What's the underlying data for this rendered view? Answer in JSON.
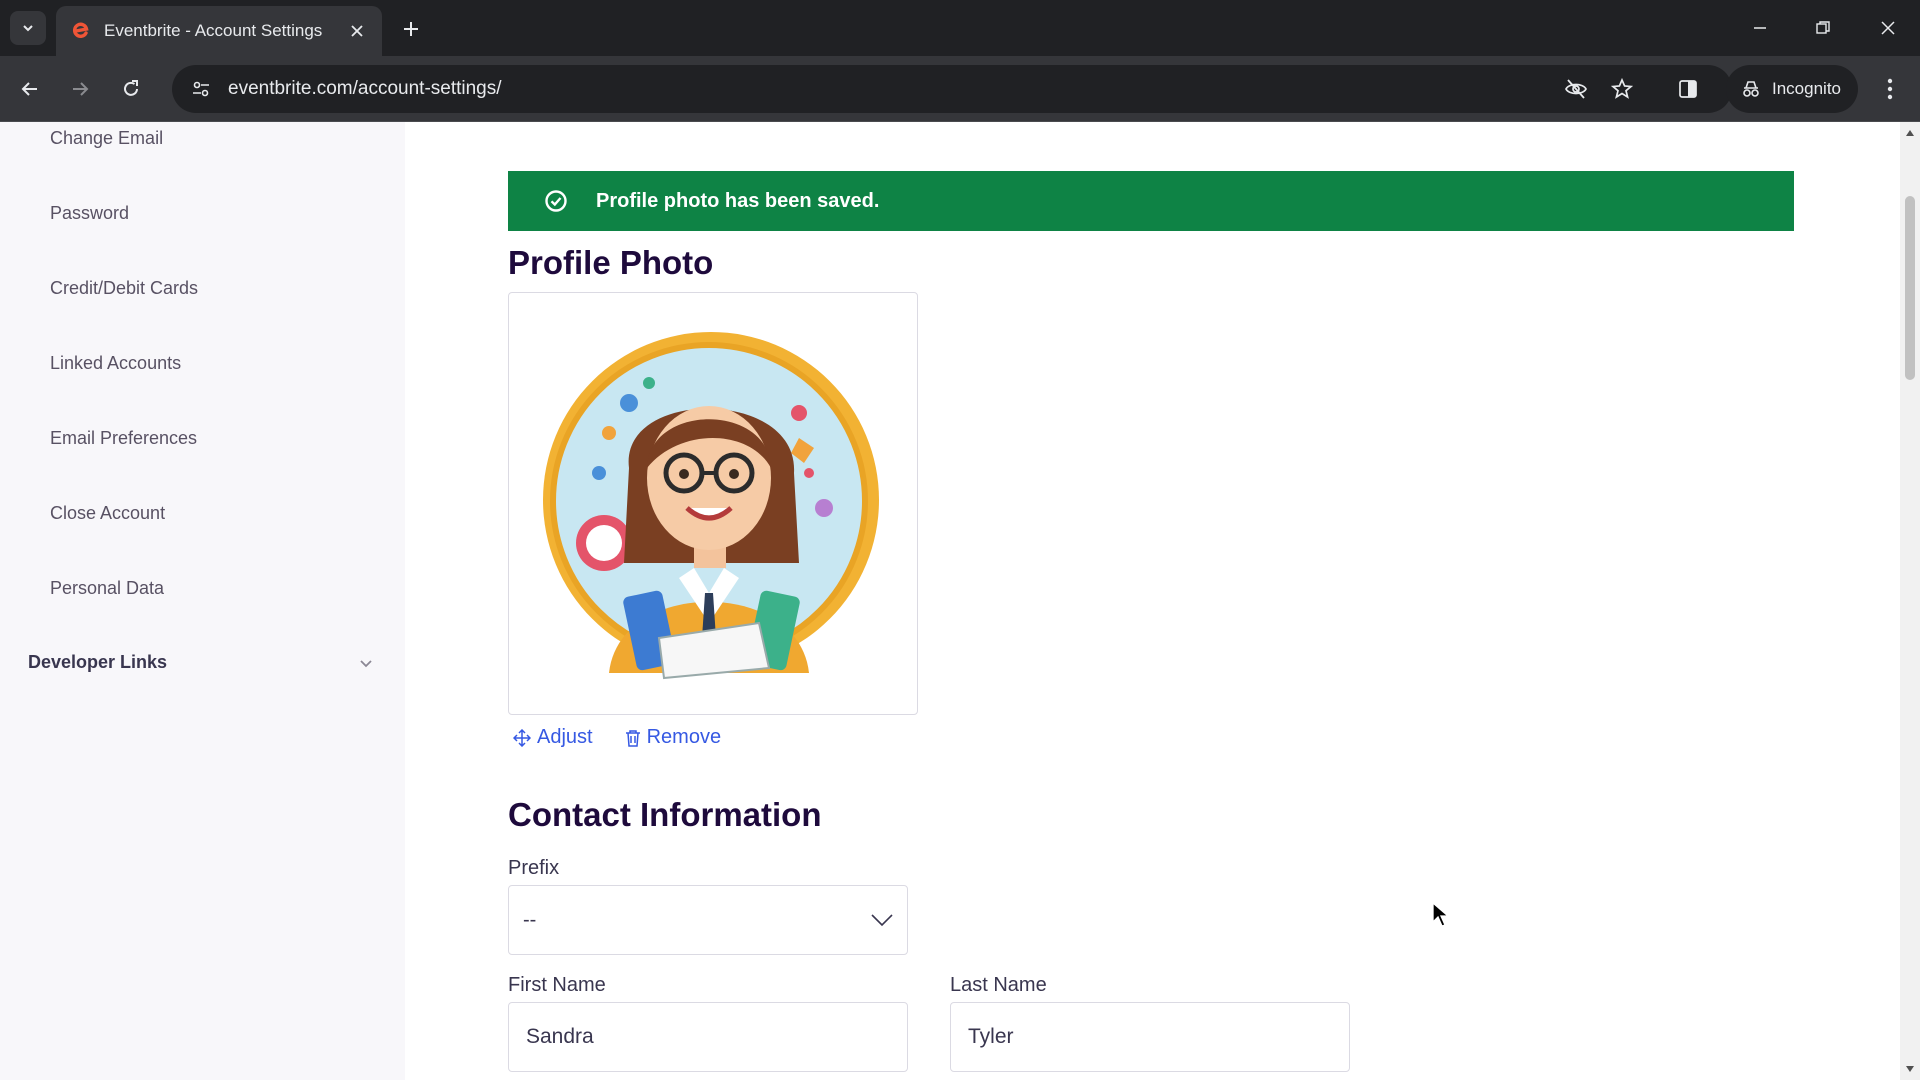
{
  "browser": {
    "tab_title": "Eventbrite - Account Settings",
    "url": "eventbrite.com/account-settings/",
    "incognito_label": "Incognito",
    "favicon_color": "#f05537"
  },
  "sidebar": {
    "items": [
      {
        "label": "Change Email"
      },
      {
        "label": "Password"
      },
      {
        "label": "Credit/Debit Cards"
      },
      {
        "label": "Linked Accounts"
      },
      {
        "label": "Email Preferences"
      },
      {
        "label": "Close Account"
      },
      {
        "label": "Personal Data"
      }
    ],
    "section_label": "Developer Links"
  },
  "banner": {
    "message": "Profile photo has been saved.",
    "color": "#0e8345"
  },
  "profile_photo": {
    "heading": "Profile Photo",
    "adjust_label": "Adjust",
    "remove_label": "Remove"
  },
  "contact": {
    "heading": "Contact Information",
    "prefix_label": "Prefix",
    "prefix_value": "--",
    "first_name_label": "First Name",
    "first_name_value": "Sandra",
    "last_name_label": "Last Name",
    "last_name_value": "Tyler"
  },
  "icons": {
    "tab_list": "chevron-down-icon",
    "close_tab": "close-icon",
    "new_tab": "plus-icon",
    "back": "arrow-left-icon",
    "forward": "arrow-right-icon",
    "reload": "reload-icon",
    "tracking": "eye-off-icon",
    "bookmark": "star-icon",
    "banner_status": "check-circle-icon",
    "adjust": "move-icon",
    "remove": "trash-icon"
  }
}
